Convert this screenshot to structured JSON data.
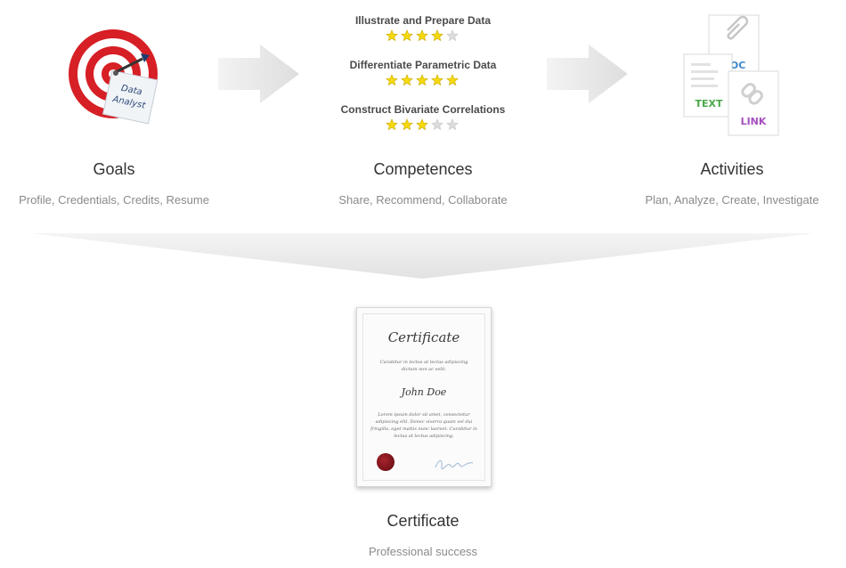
{
  "goals": {
    "title": "Goals",
    "subtitle": "Profile, Credentials, Credits, Resume",
    "note_text": "Data Analyst",
    "icon": "target-icon"
  },
  "competences": {
    "title": "Competences",
    "subtitle": "Share, Recommend, Collaborate",
    "skills": [
      {
        "name": "Illustrate and Prepare Data",
        "rating": 4,
        "max": 5
      },
      {
        "name": "Differentiate Parametric Data",
        "rating": 5,
        "max": 5
      },
      {
        "name": "Construct Bivariate Correlations",
        "rating": 3,
        "max": 5
      }
    ]
  },
  "activities": {
    "title": "Activities",
    "subtitle": "Plan, Analyze, Create, Investigate",
    "doc_label": "DOC",
    "text_label": "TEXT",
    "link_label": "LINK"
  },
  "certificate": {
    "title": "Certificate",
    "subtitle": "Professional success",
    "doc_title": "Certificate",
    "doc_intro": "Curabitur in lectus at lectus adipiscing dictum non ac velit.",
    "holder_name": "John Doe",
    "doc_body": "Lorem ipsum dolor sit amet, consectetur adipiscing elit. Donec viverra quam vel dui fringilla, eget mattis nunc laoreet. Curabitur in lectus at lectus adipiscing."
  },
  "colors": {
    "star_on": "#f5d90e",
    "star_off": "#dcdcdc",
    "doc": "#3a86c9",
    "text": "#4aa84a",
    "link": "#a64fc0",
    "target_red": "#d71f26"
  }
}
